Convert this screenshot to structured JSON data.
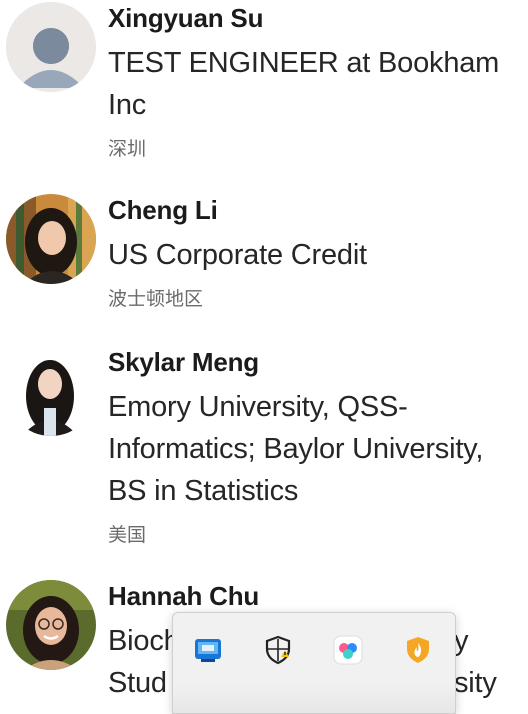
{
  "people": [
    {
      "name": "Xingyuan Su",
      "headline_lines": [
        "TEST ENGINEER at Bookham",
        "Inc"
      ],
      "location": "深圳",
      "avatar_icon": "default-avatar-icon"
    },
    {
      "name": "Cheng Li",
      "headline_lines": [
        "US Corporate Credit"
      ],
      "location": "波士顿地区",
      "avatar_icon": "profile-photo"
    },
    {
      "name": "Skylar Meng",
      "headline_lines": [
        "Emory University, QSS-",
        "Informatics; Baylor University,",
        "BS in Statistics"
      ],
      "location": "美国",
      "avatar_icon": "profile-photo"
    },
    {
      "name": "Hannah Chu",
      "headline_lines": [
        "Bioch",
        "Stud"
      ],
      "headline_right_lines": [
        "y",
        "sity"
      ],
      "avatar_icon": "profile-photo"
    }
  ],
  "tray": {
    "icons": [
      "display-app-icon",
      "security-shield-warning-icon",
      "cloud-sync-icon",
      "fire-shield-icon"
    ]
  },
  "colors": {
    "name": "#1b1b1b",
    "headline": "#262626",
    "location": "#6b6b6b",
    "default_avatar_bg": "#eae7e4",
    "default_avatar_fg": "#8fa0b3"
  }
}
